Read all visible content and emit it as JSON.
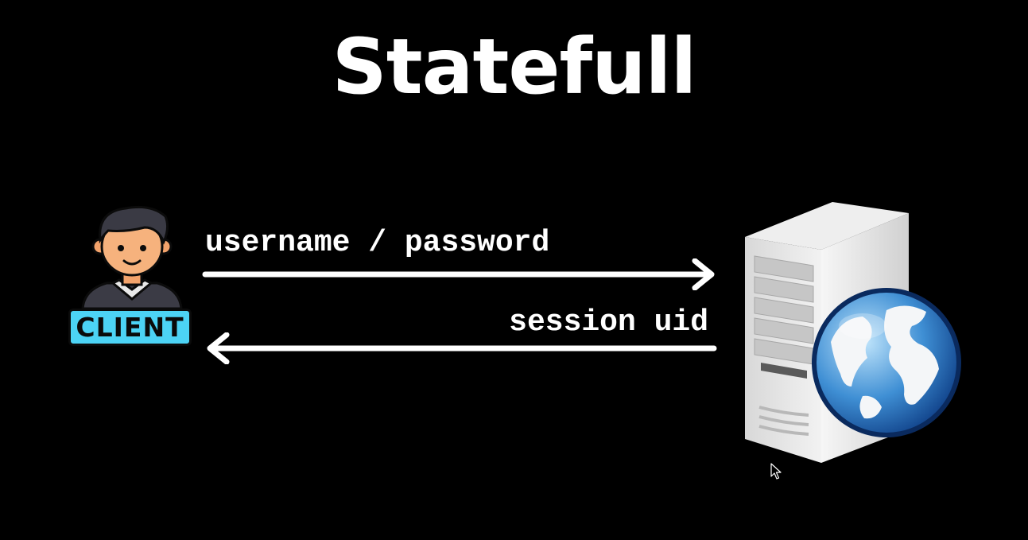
{
  "title": "Statefull",
  "client": {
    "badge_label": "CLIENT",
    "icon": "person-icon",
    "badge_color": "#4cd3f5"
  },
  "server": {
    "icon": "server-globe-icon"
  },
  "arrows": {
    "request_label": "username / password",
    "request_direction": "client-to-server",
    "response_label": "session uid",
    "response_direction": "server-to-client"
  },
  "colors": {
    "background": "#000000",
    "foreground": "#ffffff"
  }
}
